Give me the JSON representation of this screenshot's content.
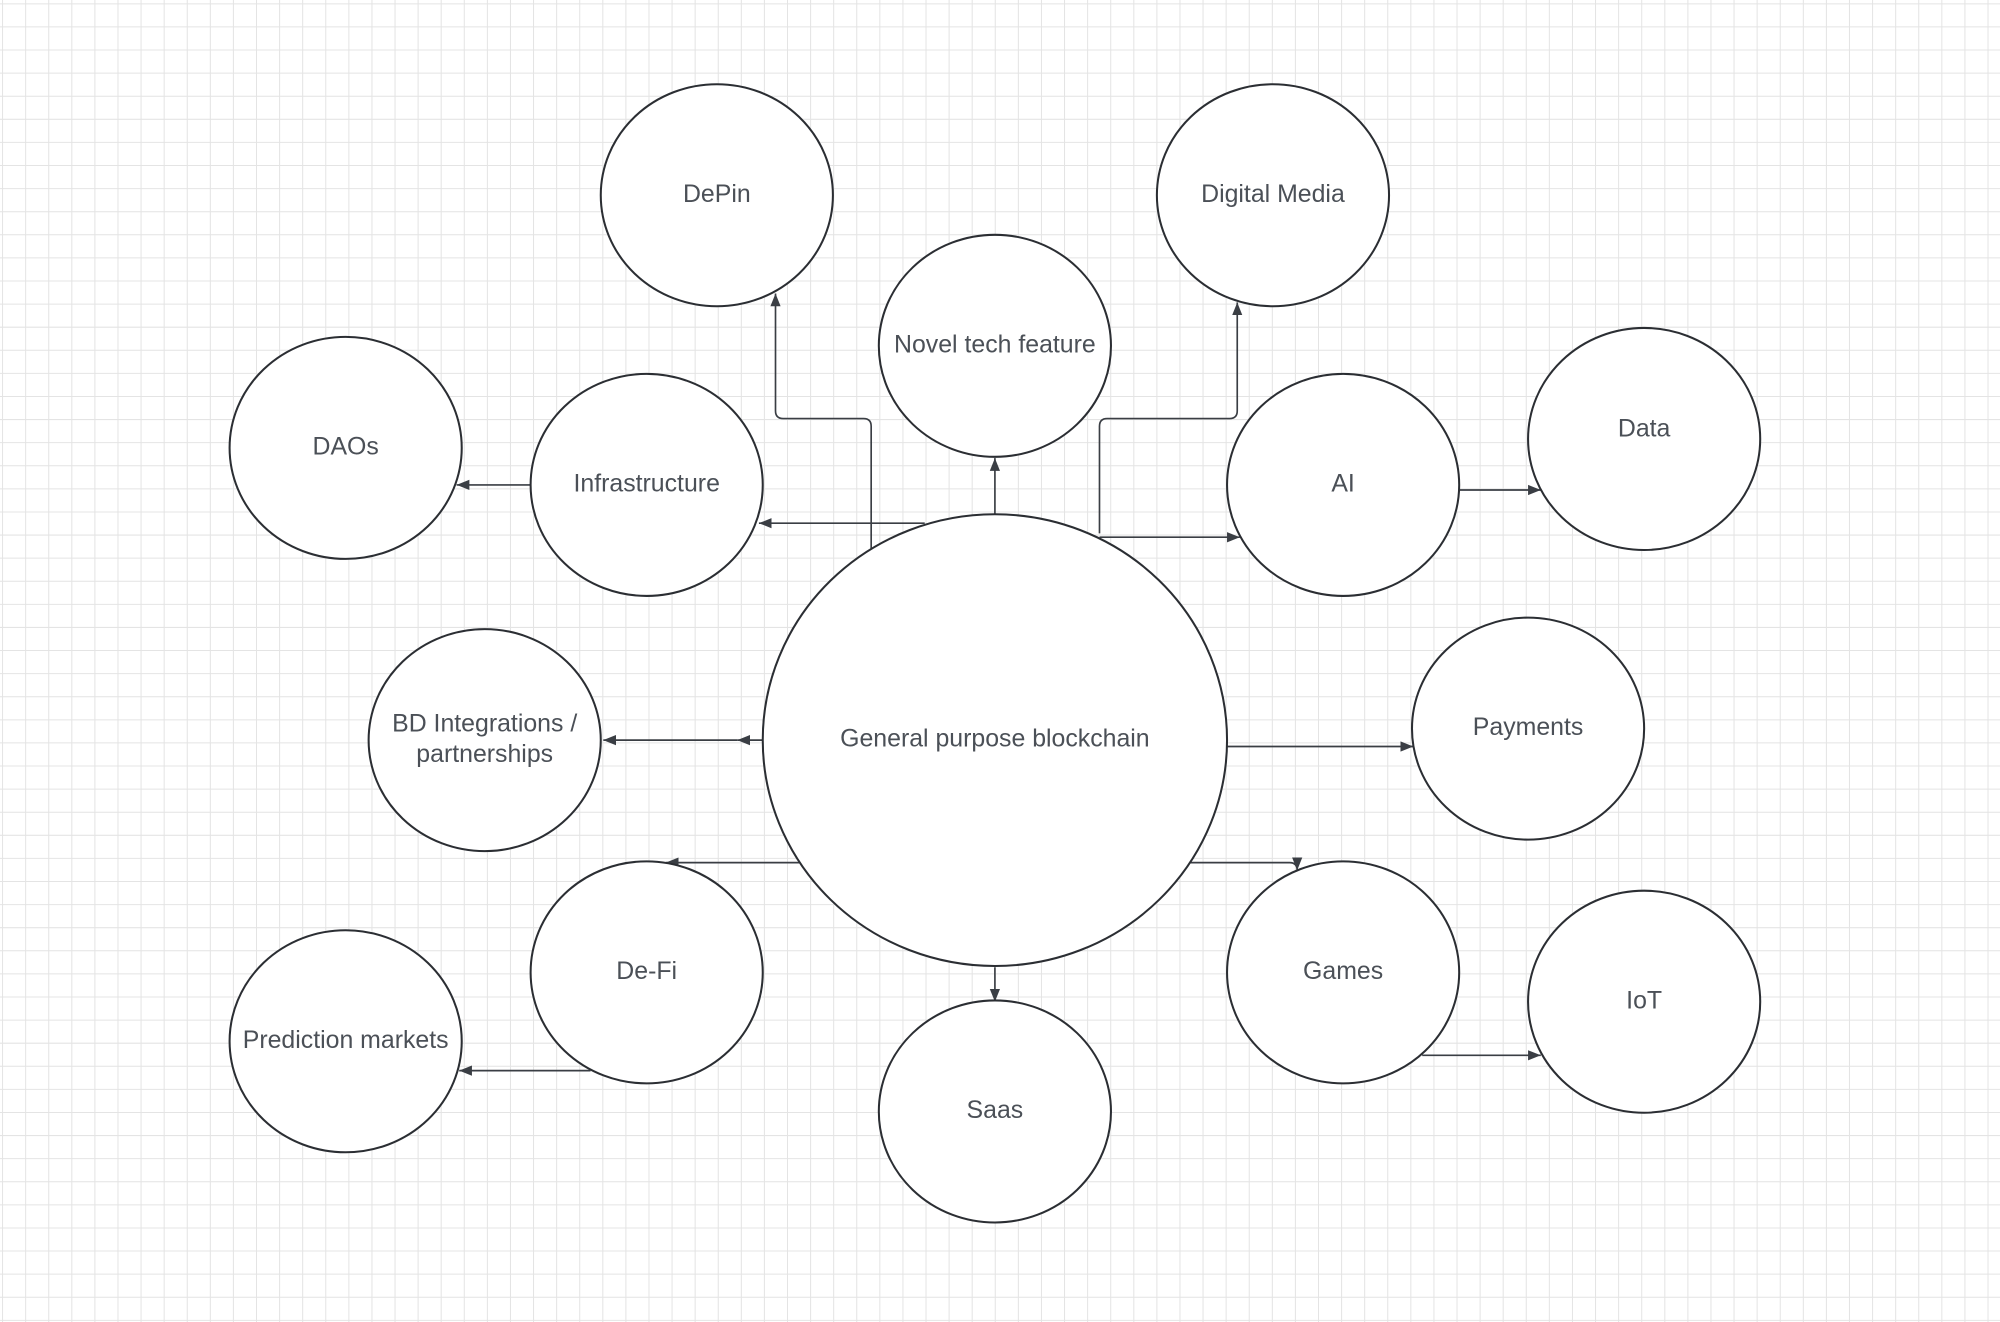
{
  "colors": {
    "grid": "#e4e4e4",
    "stroke": "#2b2e33",
    "text": "#4b5057",
    "background": "#ffffff"
  },
  "nodes": [
    {
      "id": "center",
      "label": [
        "General purpose blockchain"
      ]
    },
    {
      "id": "depin",
      "label": [
        "DePin"
      ]
    },
    {
      "id": "digital-media",
      "label": [
        "Digital Media"
      ]
    },
    {
      "id": "novel",
      "label": [
        "Novel tech feature"
      ]
    },
    {
      "id": "daos",
      "label": [
        "DAOs"
      ]
    },
    {
      "id": "infrastructure",
      "label": [
        "Infrastructure"
      ]
    },
    {
      "id": "ai",
      "label": [
        "AI"
      ]
    },
    {
      "id": "data",
      "label": [
        "Data"
      ]
    },
    {
      "id": "bd",
      "label": [
        "BD Integrations /",
        "partnerships"
      ]
    },
    {
      "id": "payments",
      "label": [
        "Payments"
      ]
    },
    {
      "id": "defi",
      "label": [
        "De-Fi"
      ]
    },
    {
      "id": "prediction",
      "label": [
        "Prediction markets"
      ]
    },
    {
      "id": "saas",
      "label": [
        "Saas"
      ]
    },
    {
      "id": "games",
      "label": [
        "Games"
      ]
    },
    {
      "id": "iot",
      "label": [
        "IoT"
      ]
    }
  ],
  "edges": [
    {
      "from": "center",
      "to": "novel"
    },
    {
      "from": "center",
      "to": "depin"
    },
    {
      "from": "center",
      "to": "digital-media"
    },
    {
      "from": "center",
      "to": "ai"
    },
    {
      "from": "center",
      "to": "infrastructure"
    },
    {
      "from": "infrastructure",
      "to": "daos"
    },
    {
      "from": "ai",
      "to": "data"
    },
    {
      "from": "center",
      "to": "bd"
    },
    {
      "from": "center",
      "to": "payments"
    },
    {
      "from": "center",
      "to": "defi"
    },
    {
      "from": "center",
      "to": "games"
    },
    {
      "from": "center",
      "to": "saas"
    },
    {
      "from": "defi",
      "to": "prediction"
    },
    {
      "from": "games",
      "to": "iot"
    }
  ]
}
